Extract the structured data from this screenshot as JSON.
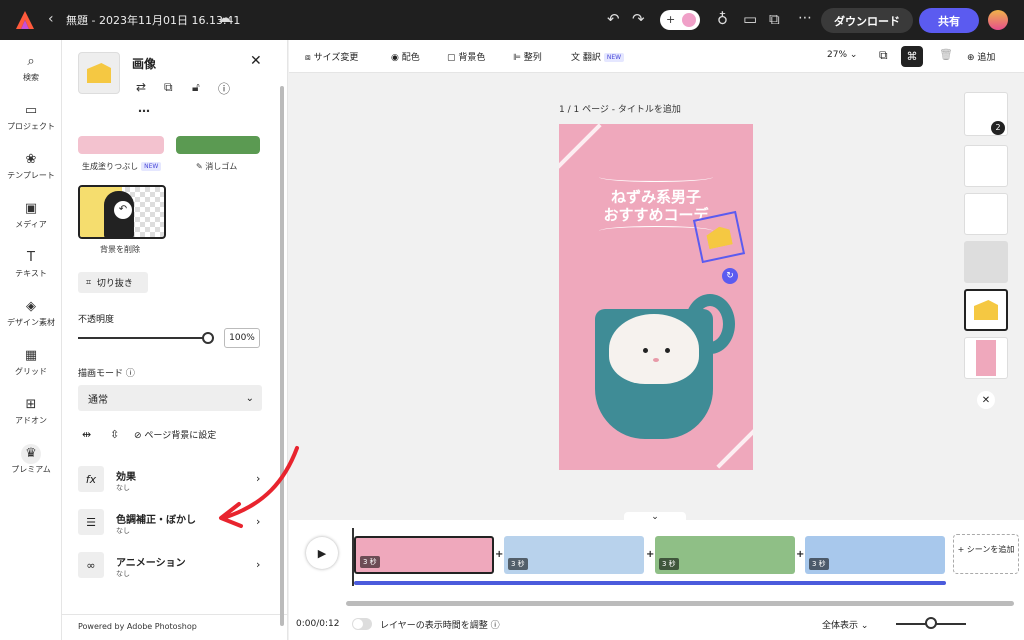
{
  "topbar": {
    "title": "無題 - 2023年11月01日 16.13.41",
    "download_label": "ダウンロード",
    "share_label": "共有"
  },
  "rail": {
    "items": [
      {
        "label": "検索",
        "icon": "search-icon"
      },
      {
        "label": "プロジェクト",
        "icon": "folder-icon"
      },
      {
        "label": "テンプレート",
        "icon": "template-icon"
      },
      {
        "label": "メディア",
        "icon": "media-icon"
      },
      {
        "label": "テキスト",
        "icon": "text-icon"
      },
      {
        "label": "デザイン素材",
        "icon": "shapes-icon"
      },
      {
        "label": "グリッド",
        "icon": "grid-icon"
      },
      {
        "label": "アドオン",
        "icon": "addon-icon"
      },
      {
        "label": "プレミアム",
        "icon": "crown-icon"
      }
    ]
  },
  "panel": {
    "title": "画像",
    "effects": [
      {
        "label": "生成塗りつぶし",
        "badge": "NEW"
      },
      {
        "label": "消しゴム"
      },
      {
        "label": "背景を削除"
      }
    ],
    "crop_label": "切り抜き",
    "opacity_label": "不透明度",
    "opacity_value": "100%",
    "opacity_level": 1.0,
    "blend_label": "描画モード",
    "blend_value": "通常",
    "set_bg_label": "ページ背景に設定",
    "rows": [
      {
        "title": "効果",
        "sub": "なし",
        "icon": "fx"
      },
      {
        "title": "色調補正・ぼかし",
        "sub": "なし",
        "icon": "⚙"
      },
      {
        "title": "アニメーション",
        "sub": "なし",
        "icon": "∞"
      }
    ],
    "powered": "Powered by Adobe Photoshop"
  },
  "toolbar": {
    "resize": "サイズ変更",
    "color": "配色",
    "bgcolor": "背景色",
    "arrange": "整列",
    "translate": "翻訳",
    "new_badge": "NEW",
    "zoom": "27%",
    "add": "追加"
  },
  "canvas": {
    "page_label": "1 / 1 ページ - タイトルを追加",
    "line1": "ねずみ系男子",
    "line2": "おすすめコーデ"
  },
  "pages": {
    "badge": "2"
  },
  "timeline": {
    "scenes": [
      {
        "duration": "3 秒",
        "color": "#efa8bc"
      },
      {
        "duration": "3 秒",
        "color": "#b8d2ec"
      },
      {
        "duration": "3 秒",
        "color": "#8fbf86"
      },
      {
        "duration": "3 秒",
        "color": "#a8c8ec"
      }
    ],
    "add_scene": "+ シーンを追加",
    "time": "0:00/0:12",
    "layer_toggle_label": "レイヤーの表示時間を調整",
    "view_label": "全体表示"
  }
}
